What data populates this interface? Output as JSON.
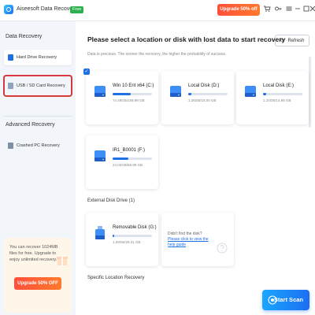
{
  "titlebar": {
    "app_name": "Aiseesoft Data Recovery",
    "free_badge": "Free",
    "upgrade_label": "Upgrade 50% off",
    "icons": [
      "cart-icon",
      "key-icon",
      "menu-icon",
      "minimize-icon",
      "maximize-icon",
      "close-icon"
    ]
  },
  "sidebar": {
    "data_recovery_title": "Data Recovery",
    "items": [
      {
        "label": "Hard Drive Recovery",
        "active": true
      },
      {
        "label": "USB / SD Card Recovery",
        "active": false
      }
    ],
    "advanced_title": "Advanced Recovery",
    "advanced_items": [
      {
        "label": "Crashed PC Recovery"
      }
    ],
    "promo": {
      "text": "You can recover 1024MB files for free. Upgrade to enjoy unlimited recovery.",
      "button_label": "Upgrade 50% OFF"
    }
  },
  "main": {
    "heading": "Please select a location or disk with lost data to start recovery",
    "subheading": "Data is precious. The sooner the recovery, the higher the probability of success.",
    "refresh_label": "Refresh",
    "drives": [
      {
        "name": "Win 10 Ent x64 (C:)",
        "size": "74.49GB/159.99 GB",
        "used": 0.47,
        "selected": true
      },
      {
        "name": "Local Disk (D:)",
        "size": "1.26GB/15.00 GB",
        "used": 0.08,
        "selected": false
      },
      {
        "name": "Local Disk (E:)",
        "size": "1.24GB/14.95 GB",
        "used": 0.08,
        "selected": false
      },
      {
        "name": "IR1_B0001 (F:)",
        "size": "24.02GB/59.99 GB",
        "used": 0.4,
        "selected": false
      }
    ],
    "external_label": "External Disk Drive (1)",
    "external_drive": {
      "name": "Removable Disk (G:)",
      "size": "1.09GB/29.31 GB",
      "used": 0.04
    },
    "help": {
      "prefix": "Didn't find the disk? ",
      "link": "Please click to view the help guide"
    },
    "specific_label": "Specific Location Recovery",
    "start_scan_label": "Start Scan"
  },
  "colors": {
    "accent": "#1f6fe5",
    "upgrade": "#ff5a36",
    "sidebar_bg": "#f2f5fa",
    "highlight_box": "#d63a3a"
  }
}
